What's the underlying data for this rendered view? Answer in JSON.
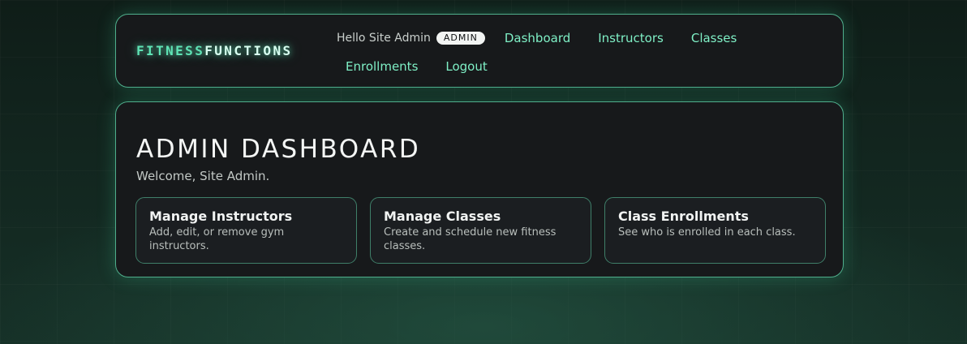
{
  "navbar": {
    "brand_part1": "FITNESS",
    "brand_part2": "FUNCTIONS",
    "greeting": "Hello Site Admin",
    "role_badge": "ADMIN",
    "links": {
      "dashboard": "Dashboard",
      "instructors": "Instructors",
      "classes": "Classes",
      "enrollments": "Enrollments",
      "logout": "Logout"
    }
  },
  "main": {
    "title": "ADMIN DASHBOARD",
    "welcome": "Welcome, Site Admin.",
    "cards": [
      {
        "title": "Manage Instructors",
        "description": "Add, edit, or remove gym instructors."
      },
      {
        "title": "Manage Classes",
        "description": "Create and schedule new fitness classes."
      },
      {
        "title": "Class Enrollments",
        "description": "See who is enrolled in each class."
      }
    ]
  },
  "colors": {
    "accent": "#5fe3b5",
    "link": "#7ff0c6",
    "panel": "#17191b",
    "border": "#4fae8c"
  }
}
